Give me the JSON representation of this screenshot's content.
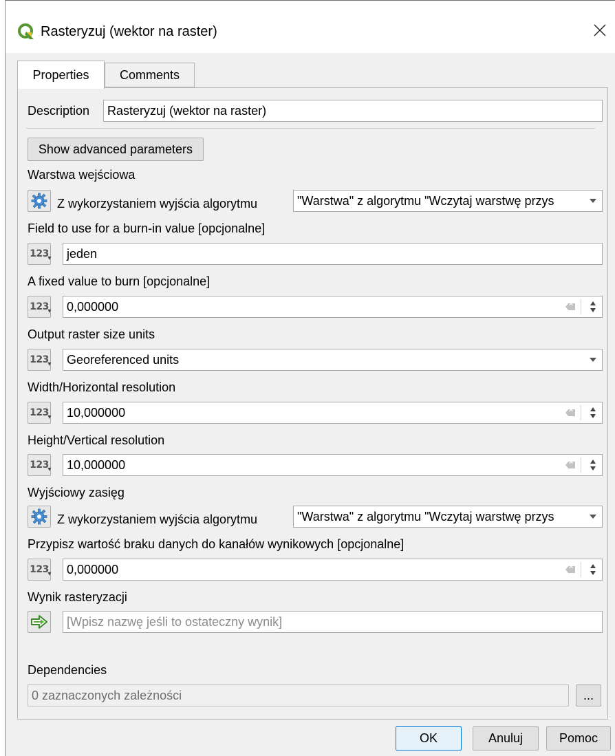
{
  "window": {
    "title": "Rasteryzuj (wektor na raster)"
  },
  "tabs": [
    {
      "label": "Properties",
      "active": true
    },
    {
      "label": "Comments",
      "active": false
    }
  ],
  "description": {
    "label": "Description",
    "value": "Rasteryzuj (wektor na raster)"
  },
  "advanced_button": "Show advanced parameters",
  "params": {
    "input_layer": {
      "label": "Warstwa wejściowa",
      "source_label": "Z wykorzystaniem wyjścia algorytmu",
      "value": "\"Warstwa\" z algorytmu \"Wczytaj warstwę przys"
    },
    "burn_field": {
      "label": "Field to use for a burn-in value [opcjonalne]",
      "value": "jeden"
    },
    "fixed_value": {
      "label": "A fixed value to burn [opcjonalne]",
      "value": "0,000000"
    },
    "size_units": {
      "label": "Output raster size units",
      "value": "Georeferenced units"
    },
    "width": {
      "label": "Width/Horizontal resolution",
      "value": "10,000000"
    },
    "height": {
      "label": "Height/Vertical resolution",
      "value": "10,000000"
    },
    "extent": {
      "label": "Wyjściowy zasięg",
      "source_label": "Z wykorzystaniem wyjścia algorytmu",
      "value": "\"Warstwa\" z algorytmu \"Wczytaj warstwę przys"
    },
    "nodata": {
      "label": "Przypisz wartość braku danych do kanałów wynikowych [opcjonalne]",
      "value": "0,000000"
    },
    "output": {
      "label": "Wynik rasteryzacji",
      "placeholder": "[Wpisz nazwę jeśli to ostateczny wynik]"
    }
  },
  "dependencies": {
    "label": "Dependencies",
    "value": "0 zaznaczonych zależności",
    "browse": "..."
  },
  "buttons": {
    "ok": "OK",
    "cancel": "Anuluj",
    "help": "Pomoc"
  },
  "colors": {
    "accent": "#0078d7",
    "qgis_green": "#589632",
    "qgis_yellow": "#f0c020",
    "gear_blue": "#4a90d9"
  }
}
